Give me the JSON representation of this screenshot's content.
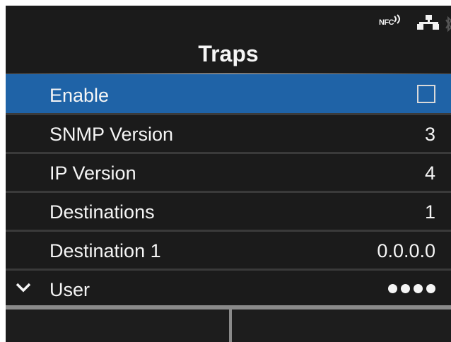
{
  "status": {
    "nfc_label": "NFC",
    "icons": [
      "nfc-icon",
      "network-icon",
      "bluetooth-icon"
    ]
  },
  "screen_title": "Traps",
  "menu": [
    {
      "label": "Enable",
      "control": "checkbox",
      "checked": false,
      "selected": true
    },
    {
      "label": "SNMP Version",
      "value": "3"
    },
    {
      "label": "IP Version",
      "value": "4"
    },
    {
      "label": "Destinations",
      "value": "1"
    },
    {
      "label": "Destination 1",
      "value": "0.0.0.0"
    },
    {
      "label": "User",
      "masked": true,
      "more_below": true
    }
  ],
  "colors": {
    "background": "#1b1b1b",
    "selected_row": "#1f63a7",
    "text": "#f5f5f5"
  },
  "softkeys": [
    "",
    ""
  ]
}
